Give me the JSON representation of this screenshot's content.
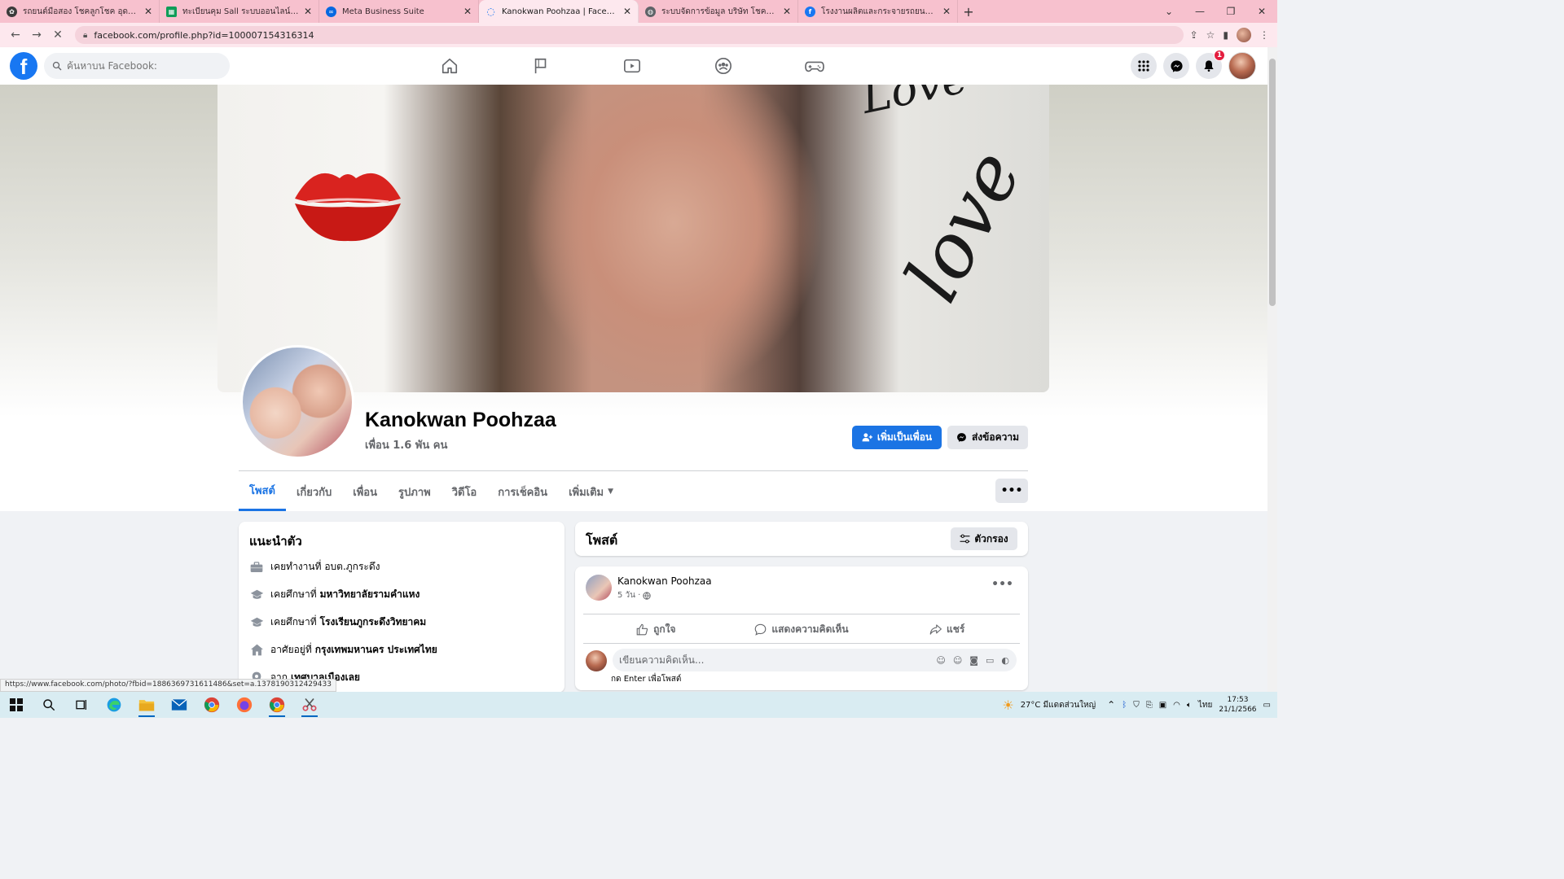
{
  "browser": {
    "tabs": [
      {
        "title": "รถยนต์มือสอง โชคลูกโชค อุดรธานี",
        "fav_color": "#3b3b3b",
        "fav_glyph": "✿",
        "active": false
      },
      {
        "title": "ทะเบียนคุม Sall ระบบออนไลน์.xlsx - G",
        "fav_color": "#0f9d58",
        "fav_glyph": "▦",
        "active": false
      },
      {
        "title": "Meta Business Suite",
        "fav_color": "#0668e1",
        "fav_glyph": "∞",
        "active": false
      },
      {
        "title": "Kanokwan Poohzaa | Facebook",
        "fav_color": "#1877f2",
        "fav_glyph": "◌",
        "active": true
      },
      {
        "title": "ระบบจัดการข้อมูล บริษัท โชคลูกโชค",
        "fav_color": "#5f6368",
        "fav_glyph": "◍",
        "active": false
      },
      {
        "title": "โรงงานผลิตและกระจายรถยนต์ใช้แล้ว",
        "fav_color": "#1877f2",
        "fav_glyph": "f",
        "active": false
      }
    ],
    "url": "facebook.com/profile.php?id=100007154316314",
    "status_url": "https://www.facebook.com/photo/?fbid=1886369731611486&set=a.1378190312429433"
  },
  "fb": {
    "search_placeholder": "ค้นหาบน Facebook:",
    "notifications_count": "1"
  },
  "profile": {
    "name": "Kanokwan Poohzaa",
    "friends": "เพื่อน 1.6 พัน คน",
    "add_friend_label": "เพิ่มเป็นเพื่อน",
    "message_label": "ส่งข้อความ",
    "cover_text_1": "love",
    "cover_text_2": "Love",
    "tabs": [
      "โพสต์",
      "เกี่ยวกับ",
      "เพื่อน",
      "รูปภาพ",
      "วิดีโอ",
      "การเช็คอิน",
      "เพิ่มเติม"
    ]
  },
  "intro": {
    "title": "แนะนำตัว",
    "rows": [
      {
        "prefix": "เคยทำงานที่ อบต.ภูกระดึง",
        "bold": ""
      },
      {
        "prefix": "เคยศึกษาที่",
        "bold": "มหาวิทยาลัยรามคำแหง"
      },
      {
        "prefix": "เคยศึกษาที่",
        "bold": "โรงเรียนภูกระดึงวิทยาคม"
      },
      {
        "prefix": "อาศัยอยู่ที่",
        "bold": "กรุงเทพมหานคร ประเทศไทย"
      },
      {
        "prefix": "จาก",
        "bold": "เทศบาลเมืองเลย"
      }
    ]
  },
  "posts": {
    "title": "โพสต์",
    "filter_label": "ตัวกรอง",
    "author": "Kanokwan Poohzaa",
    "time": "5 วัน ·",
    "like_label": "ถูกใจ",
    "comment_label": "แสดงความคิดเห็น",
    "share_label": "แชร์",
    "comment_placeholder": "เขียนความคิดเห็น...",
    "enter_hint": "กด Enter เพื่อโพสต์"
  },
  "taskbar": {
    "weather": "27°C  มีแดดส่วนใหญ่",
    "lang": "ไทย",
    "time": "17:53",
    "date": "21/1/2566"
  },
  "colors": {
    "fb_blue": "#1877f2",
    "tab_strip": "#f7c1ce"
  }
}
